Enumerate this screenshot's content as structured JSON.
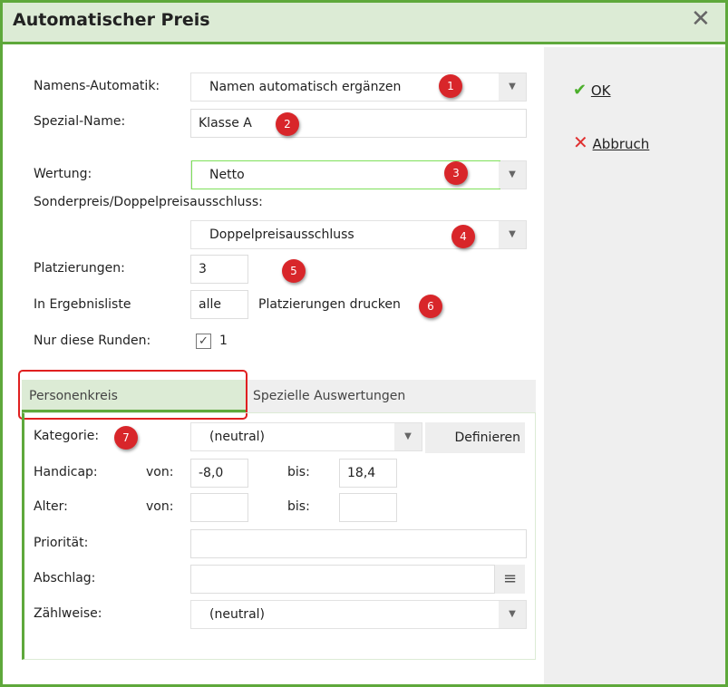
{
  "window": {
    "title": "Automatischer Preis",
    "close_icon": "close-icon"
  },
  "actions": {
    "ok": "OK",
    "cancel": "Abbruch"
  },
  "form": {
    "namens_label": "Namens-Automatik:",
    "namens_value": "Namen automatisch ergänzen",
    "spezial_label": "Spezial-Name:",
    "spezial_value": "Klasse A",
    "wertung_label": "Wertung:",
    "wertung_value": "Netto",
    "sonder_label": "Sonderpreis/Doppelpreisausschluss:",
    "sonder_value": "Doppelpreisausschluss",
    "platz_label": "Platzierungen:",
    "platz_value": "3",
    "ergebnis_label": "In Ergebnisliste",
    "ergebnis_value": "alle",
    "ergebnis_suffix": "Platzierungen drucken",
    "runden_label": "Nur diese Runden:",
    "runden_value": "1",
    "runden_checked": true
  },
  "tabs": [
    {
      "label": "Personenkreis",
      "active": true
    },
    {
      "label": "Spezielle Auswertungen",
      "active": false
    }
  ],
  "personenkreis": {
    "kategorie_label": "Kategorie:",
    "kategorie_value": "(neutral)",
    "definieren": "Definieren",
    "handicap_label": "Handicap:",
    "von": "von:",
    "bis": "bis:",
    "handicap_von": "-8,0",
    "handicap_bis": "18,4",
    "alter_label": "Alter:",
    "alter_von": "",
    "alter_bis": "",
    "prioritaet_label": "Priorität:",
    "prioritaet_value": "",
    "abschlag_label": "Abschlag:",
    "abschlag_value": "",
    "zaehlweise_label": "Zählweise:",
    "zaehlweise_value": "(neutral)"
  },
  "badges": [
    "1",
    "2",
    "3",
    "4",
    "5",
    "6",
    "7"
  ],
  "colors": {
    "accent": "#5ea83b",
    "titlebar": "#dcebd5",
    "badge": "#d8262a"
  }
}
